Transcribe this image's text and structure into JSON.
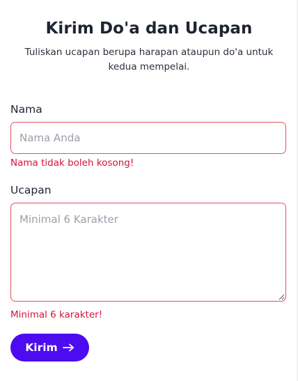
{
  "form": {
    "title": "Kirim Do'a dan Ucapan",
    "subtitle": "Tuliskan ucapan berupa harapan ataupun do'a untuk kedua mempelai.",
    "name_label": "Nama",
    "name_placeholder": "Nama Anda",
    "name_value": "",
    "name_error": "Nama tidak boleh kosong!",
    "message_label": "Ucapan",
    "message_placeholder": "Minimal 6 Karakter",
    "message_value": "",
    "message_error": "Minimal 6 karakter!",
    "submit_label": "Kirim",
    "submit_icon": "arrow-right-icon"
  },
  "colors": {
    "accent": "#4c0bf0",
    "error": "#d6113b",
    "error_border": "#e05263",
    "text": "#1f2433",
    "placeholder": "#9aa0a9"
  }
}
